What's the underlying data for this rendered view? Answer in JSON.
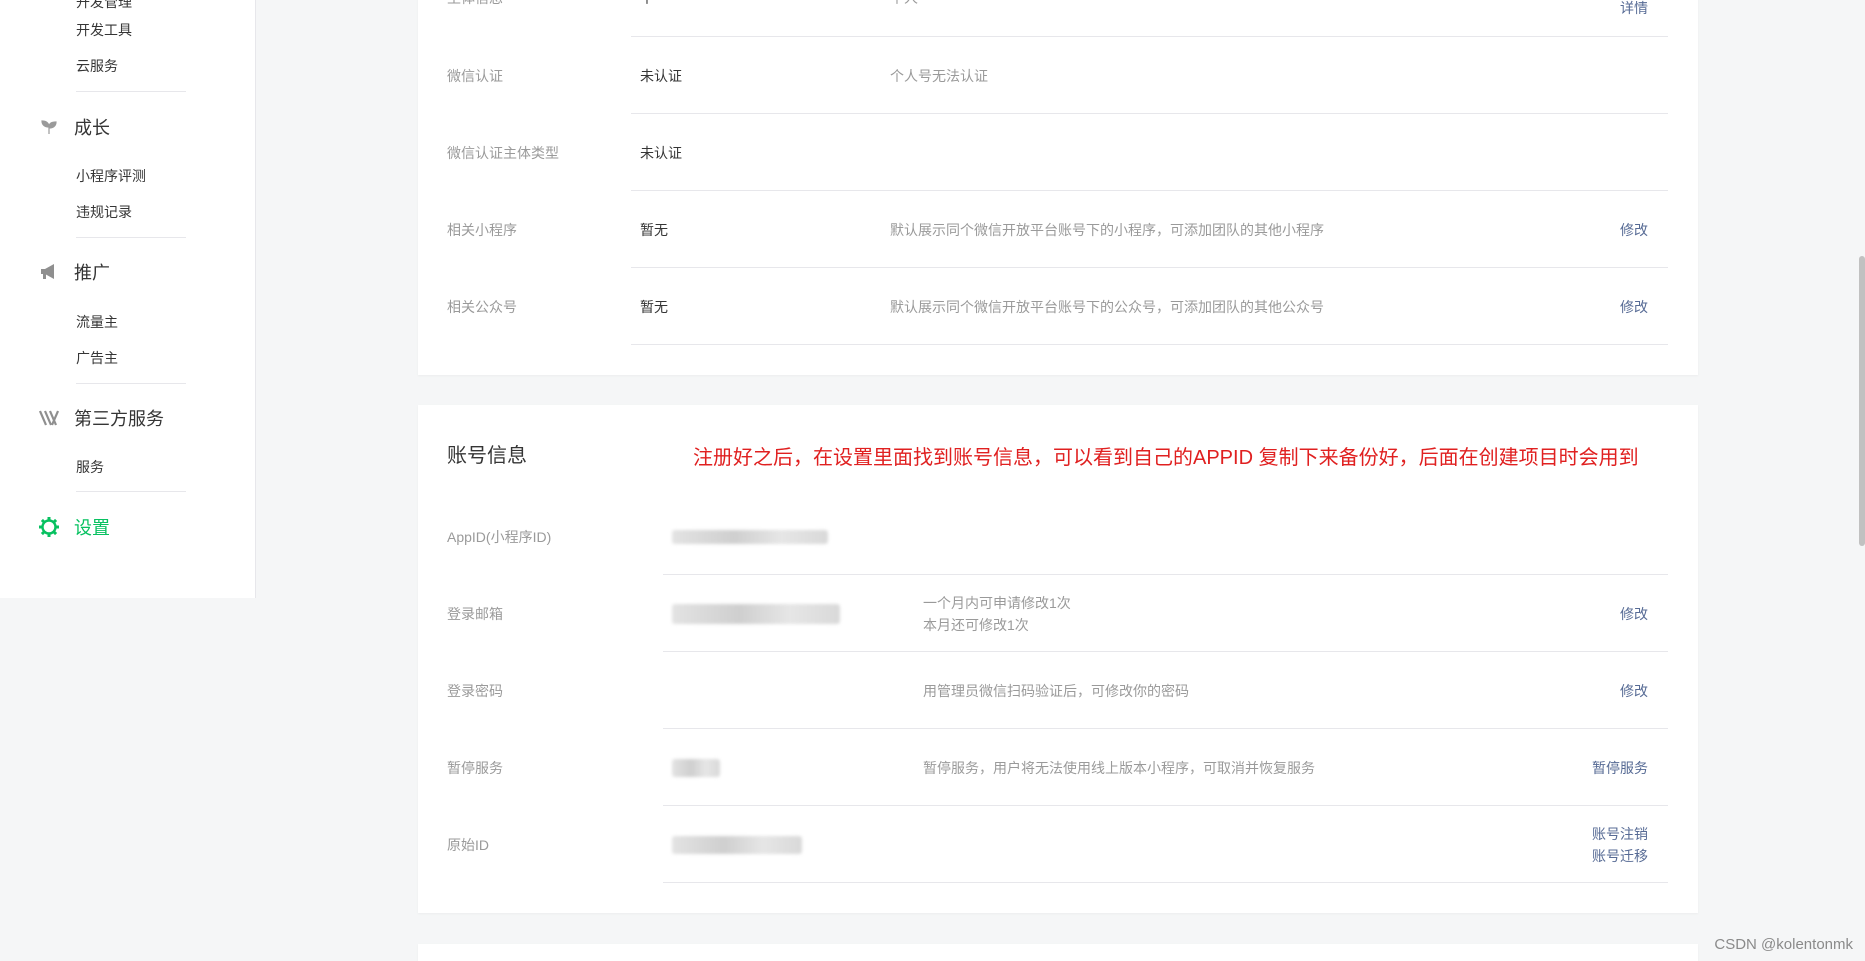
{
  "sidebar": {
    "top_partial": "开发管理",
    "dev_items": [
      "开发工具",
      "云服务"
    ],
    "growth": {
      "label": "成长",
      "items": [
        "小程序评测",
        "违规记录"
      ]
    },
    "promo": {
      "label": "推广",
      "items": [
        "流量主",
        "广告主"
      ]
    },
    "third": {
      "label": "第三方服务",
      "items": [
        "服务"
      ]
    },
    "settings": {
      "label": "设置"
    }
  },
  "basic": {
    "rows": [
      {
        "label": "主体信息",
        "value": "个",
        "desc": "个人",
        "action": "详情"
      },
      {
        "label": "微信认证",
        "value": "未认证",
        "desc": "个人号无法认证",
        "action": ""
      },
      {
        "label": "微信认证主体类型",
        "value": "未认证",
        "desc": "",
        "action": ""
      },
      {
        "label": "相关小程序",
        "value": "暂无",
        "desc": "默认展示同个微信开放平台账号下的小程序，可添加团队的其他小程序",
        "action": "修改"
      },
      {
        "label": "相关公众号",
        "value": "暂无",
        "desc": "默认展示同个微信开放平台账号下的公众号，可添加团队的其他公众号",
        "action": "修改"
      }
    ]
  },
  "account": {
    "title": "账号信息",
    "annotation": "注册好之后，在设置里面找到账号信息，可以看到自己的APPID 复制下来备份好，后面在创建项目时会用到",
    "rows": [
      {
        "label": "AppID(小程序ID)",
        "desc_1": "",
        "desc_2": "",
        "action_1": "",
        "action_2": ""
      },
      {
        "label": "登录邮箱",
        "desc_1": "一个月内可申请修改1次",
        "desc_2": "本月还可修改1次",
        "action_1": "修改",
        "action_2": ""
      },
      {
        "label": "登录密码",
        "desc_1": "用管理员微信扫码验证后，可修改你的密码",
        "desc_2": "",
        "action_1": "修改",
        "action_2": ""
      },
      {
        "label": "暂停服务",
        "desc_1": "暂停服务，用户将无法使用线上版本小程序，可取消并恢复服务",
        "desc_2": "",
        "action_1": "暂停服务",
        "action_2": ""
      },
      {
        "label": "原始ID",
        "desc_1": "",
        "desc_2": "",
        "action_1": "账号注销",
        "action_2": "账号迁移"
      }
    ]
  },
  "watermark": "CSDN @kolentonmk",
  "colors": {
    "accent": "#07c160",
    "link": "#576b95",
    "annotation": "#e02020"
  }
}
